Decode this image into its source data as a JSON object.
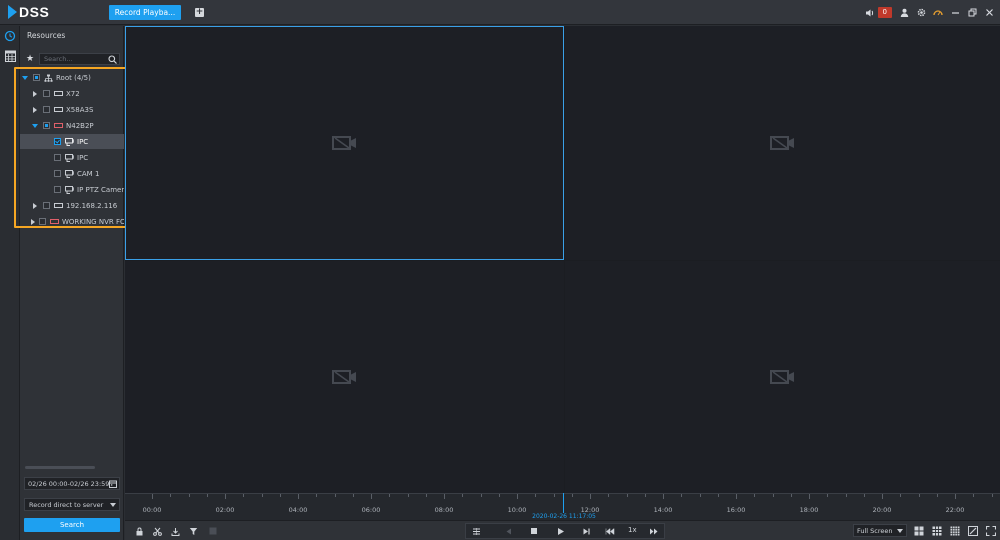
{
  "app": {
    "logo_text": "DSS",
    "active_tab": "Record Playba...",
    "alarm_count": "0",
    "accent": "#1ea0f0",
    "highlight_color": "#f5a623"
  },
  "panel": {
    "title": "Resources",
    "search_placeholder": "Search...",
    "tree": [
      {
        "label": "Root (4/5)",
        "level": 0,
        "expanded": true,
        "check": "partial",
        "icon": "root-icon"
      },
      {
        "label": "X72",
        "level": 1,
        "expanded": false,
        "check": "none",
        "icon": "nvr-icon"
      },
      {
        "label": "X58A3S",
        "level": 1,
        "expanded": false,
        "check": "none",
        "icon": "nvr-icon"
      },
      {
        "label": "N42B2P",
        "level": 1,
        "expanded": true,
        "check": "partial",
        "icon": "nvr-icon-red"
      },
      {
        "label": "IPC",
        "level": 2,
        "check": "checked",
        "icon": "camera-icon",
        "selected": true
      },
      {
        "label": "IPC",
        "level": 2,
        "check": "none",
        "icon": "camera-icon"
      },
      {
        "label": "CAM 1",
        "level": 2,
        "check": "none",
        "icon": "camera-icon"
      },
      {
        "label": "IP PTZ Camera",
        "level": 2,
        "check": "none",
        "icon": "camera-icon"
      },
      {
        "label": "192.168.2.116",
        "level": 1,
        "expanded": false,
        "check": "none",
        "icon": "nvr-icon"
      },
      {
        "label": "WORKING NVR FO",
        "level": 1,
        "expanded": false,
        "check": "none",
        "icon": "nvr-icon-red"
      }
    ],
    "date_range": "02/26 00:00-02/26 23:59",
    "record_source": "Record direct to server",
    "search_button": "Search"
  },
  "timeline": {
    "ticks": [
      "00:00",
      "02:00",
      "04:00",
      "06:00",
      "08:00",
      "10:00",
      "12:00",
      "14:00",
      "16:00",
      "18:00",
      "20:00",
      "22:00"
    ],
    "current_time": "2020-02-26 11:17:05"
  },
  "toolbar": {
    "speed": "1x",
    "fullscreen_label": "Full Screen"
  }
}
